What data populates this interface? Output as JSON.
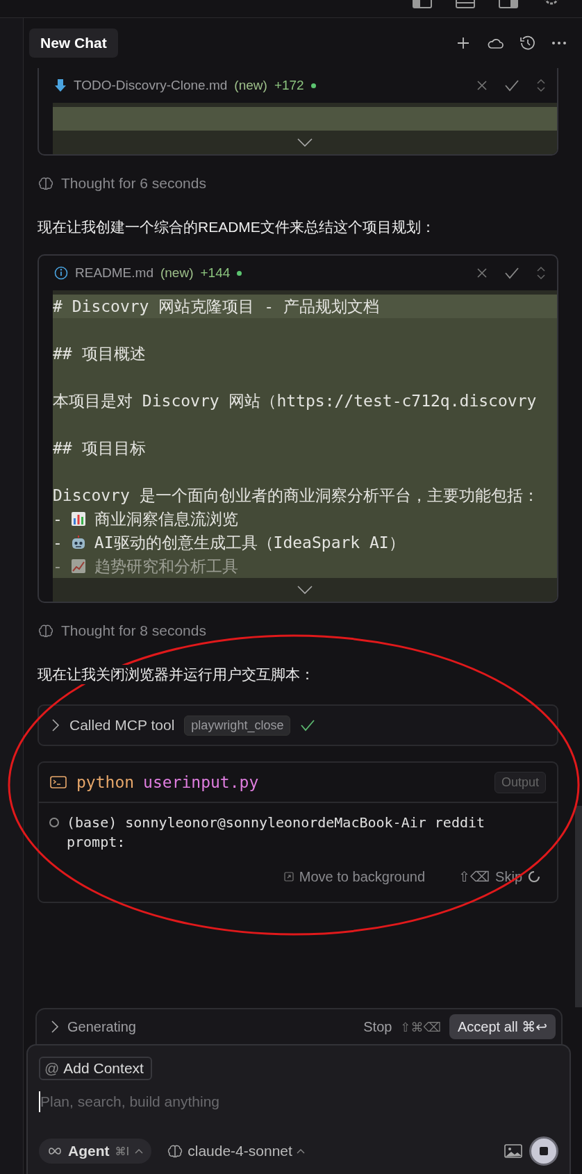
{
  "chat_tab": {
    "title": "New Chat"
  },
  "messages": [
    {
      "kind": "file_edit",
      "filename": "TODO-Discovry-Clone.md",
      "status": "(new)",
      "added": "+172",
      "lines": [
        {
          "kind": "blank",
          "highlighted": true
        }
      ]
    },
    {
      "kind": "thought",
      "text": "Thought for 6 seconds"
    },
    {
      "kind": "text",
      "text": "现在让我创建一个综合的README文件来总结这个项目规划："
    },
    {
      "kind": "file_edit",
      "filename": "README.md",
      "status": "(new)",
      "added": "+144",
      "lines": [
        {
          "kind": "code",
          "text": "# Discovry 网站克隆项目 - 产品规划文档",
          "highlighted": true
        },
        {
          "kind": "blank",
          "highlighted": false
        },
        {
          "kind": "code",
          "text": "## 项目概述",
          "highlighted": false
        },
        {
          "kind": "blank",
          "highlighted": false
        },
        {
          "kind": "code",
          "text": "本项目是对 Discovry 网站（https://test-c712q.discovry",
          "highlighted": false
        },
        {
          "kind": "blank",
          "highlighted": false
        },
        {
          "kind": "code",
          "text": "## 项目目标",
          "highlighted": false
        },
        {
          "kind": "blank",
          "highlighted": false
        },
        {
          "kind": "code",
          "text": "Discovry 是一个面向创业者的商业洞察分析平台，主要功能包括：",
          "highlighted": false
        },
        {
          "kind": "bullet",
          "marker": "-",
          "text": "商业洞察信息流浏览",
          "highlighted": false
        },
        {
          "kind": "bullet",
          "marker": "-",
          "text": "AI驱动的创意生成工具（IdeaSpark AI）",
          "highlighted": false
        },
        {
          "kind": "bullet",
          "marker": "-",
          "text": "趋势研究和分析工具",
          "highlighted": false
        }
      ]
    },
    {
      "kind": "thought",
      "text": "Thought for 8 seconds"
    },
    {
      "kind": "text",
      "text": "现在让我关闭浏览器并运行用户交互脚本："
    },
    {
      "kind": "tool_call",
      "label": "Called MCP tool",
      "tool": "playwright_close",
      "done": true
    },
    {
      "kind": "terminal",
      "command": "python",
      "argument": "userinput.py",
      "output_label": "Output",
      "output_lines": [
        "(base) sonnyleonor@sonnyleonordeMacBook-Air reddit",
        "prompt:"
      ],
      "move_label": "Move to background",
      "skip_keys": "⇧⌫",
      "skip_label": "Skip",
      "running": true
    }
  ],
  "generating": {
    "label": "Generating",
    "stop_label": "Stop",
    "stop_keys": "⇧⌘⌫",
    "accept_label": "Accept all",
    "accept_keys": "⌘↩"
  },
  "composer": {
    "context_symbol": "@",
    "context_label": "Add Context",
    "placeholder": "Plan, search, build anything",
    "mode": "Agent",
    "mode_keys": "⌘I",
    "model": "claude-4-sonnet"
  },
  "annotation": {
    "kind": "ellipse"
  }
}
